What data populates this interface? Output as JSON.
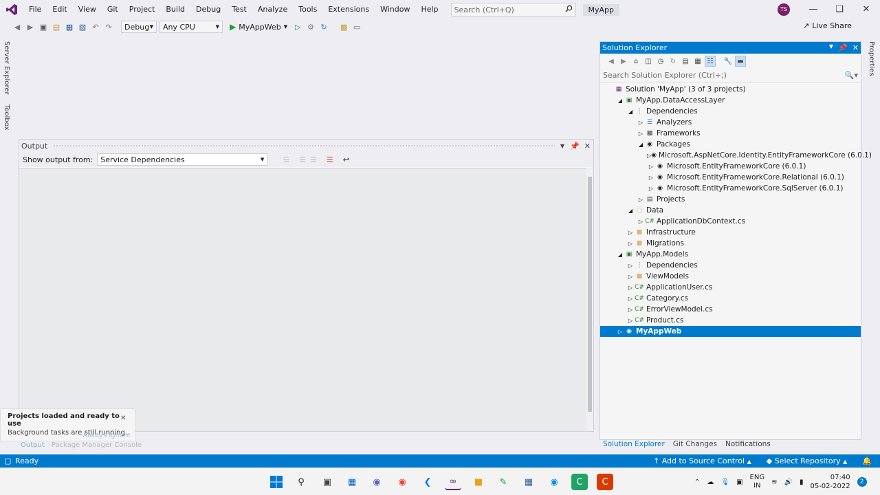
{
  "menu": {
    "items": [
      "File",
      "Edit",
      "View",
      "Git",
      "Project",
      "Build",
      "Debug",
      "Test",
      "Analyze",
      "Tools",
      "Extensions",
      "Window",
      "Help"
    ],
    "search_placeholder": "Search (Ctrl+Q)",
    "app_title": "MyApp",
    "avatar_initials": "TS"
  },
  "toolbar": {
    "config": "Debug",
    "platform": "Any CPU",
    "run_target": "MyAppWeb",
    "live_share": "Live Share"
  },
  "side_tabs": [
    "Server Explorer",
    "Toolbox"
  ],
  "right_tabs": [
    "Properties"
  ],
  "output": {
    "title": "Output",
    "show_from_label": "Show output from:",
    "source": "Service Dependencies"
  },
  "toast": {
    "title": "Projects loaded and ready to use",
    "subtitle": "Background tasks are still running.",
    "action": "Always ignore"
  },
  "bottom_tabs": [
    "Output",
    "Package Manager Console"
  ],
  "solution_explorer": {
    "title": "Solution Explorer",
    "search_placeholder": "Search Solution Explorer (Ctrl+;)",
    "tree": [
      {
        "label": "Solution 'MyApp' (3 of 3 projects)",
        "indent": 0,
        "arrow": "",
        "icon": "solution"
      },
      {
        "label": "MyApp.DataAccessLayer",
        "indent": 1,
        "arrow": "open",
        "icon": "project"
      },
      {
        "label": "Dependencies",
        "indent": 2,
        "arrow": "open",
        "icon": "deps"
      },
      {
        "label": "Analyzers",
        "indent": 3,
        "arrow": "closed",
        "icon": "analyzer"
      },
      {
        "label": "Frameworks",
        "indent": 3,
        "arrow": "closed",
        "icon": "framework"
      },
      {
        "label": "Packages",
        "indent": 3,
        "arrow": "open",
        "icon": "package"
      },
      {
        "label": "Microsoft.AspNetCore.Identity.EntityFrameworkCore (6.0.1)",
        "indent": 4,
        "arrow": "closed",
        "icon": "package"
      },
      {
        "label": "Microsoft.EntityFrameworkCore (6.0.1)",
        "indent": 4,
        "arrow": "closed",
        "icon": "package"
      },
      {
        "label": "Microsoft.EntityFrameworkCore.Relational (6.0.1)",
        "indent": 4,
        "arrow": "closed",
        "icon": "package"
      },
      {
        "label": "Microsoft.EntityFrameworkCore.SqlServer (6.0.1)",
        "indent": 4,
        "arrow": "closed",
        "icon": "package"
      },
      {
        "label": "Projects",
        "indent": 3,
        "arrow": "closed",
        "icon": "projects"
      },
      {
        "label": "Data",
        "indent": 2,
        "arrow": "open",
        "icon": "folder-open"
      },
      {
        "label": "ApplicationDbContext.cs",
        "indent": 3,
        "arrow": "closed",
        "icon": "cs"
      },
      {
        "label": "Infrastructure",
        "indent": 2,
        "arrow": "closed",
        "icon": "folder"
      },
      {
        "label": "Migrations",
        "indent": 2,
        "arrow": "closed",
        "icon": "folder"
      },
      {
        "label": "MyApp.Models",
        "indent": 1,
        "arrow": "open",
        "icon": "project"
      },
      {
        "label": "Dependencies",
        "indent": 2,
        "arrow": "closed",
        "icon": "deps"
      },
      {
        "label": "ViewModels",
        "indent": 2,
        "arrow": "closed",
        "icon": "folder"
      },
      {
        "label": "ApplicationUser.cs",
        "indent": 2,
        "arrow": "closed",
        "icon": "cs"
      },
      {
        "label": "Category.cs",
        "indent": 2,
        "arrow": "closed",
        "icon": "cs"
      },
      {
        "label": "ErrorViewModel.cs",
        "indent": 2,
        "arrow": "closed",
        "icon": "cs"
      },
      {
        "label": "Product.cs",
        "indent": 2,
        "arrow": "closed",
        "icon": "cs"
      },
      {
        "label": "MyAppWeb",
        "indent": 1,
        "arrow": "closed",
        "icon": "web",
        "selected": true
      }
    ],
    "tabs": [
      "Solution Explorer",
      "Git Changes",
      "Notifications"
    ]
  },
  "status": {
    "ready": "Ready",
    "source_control": "Add to Source Control",
    "repository": "Select Repository"
  },
  "taskbar": {
    "lang_top": "ENG",
    "lang_bottom": "IN",
    "time": "07:40",
    "date": "05-02-2022",
    "notif_count": "2"
  },
  "colors": {
    "accent": "#007acc",
    "vs_purple": "#68217a"
  }
}
